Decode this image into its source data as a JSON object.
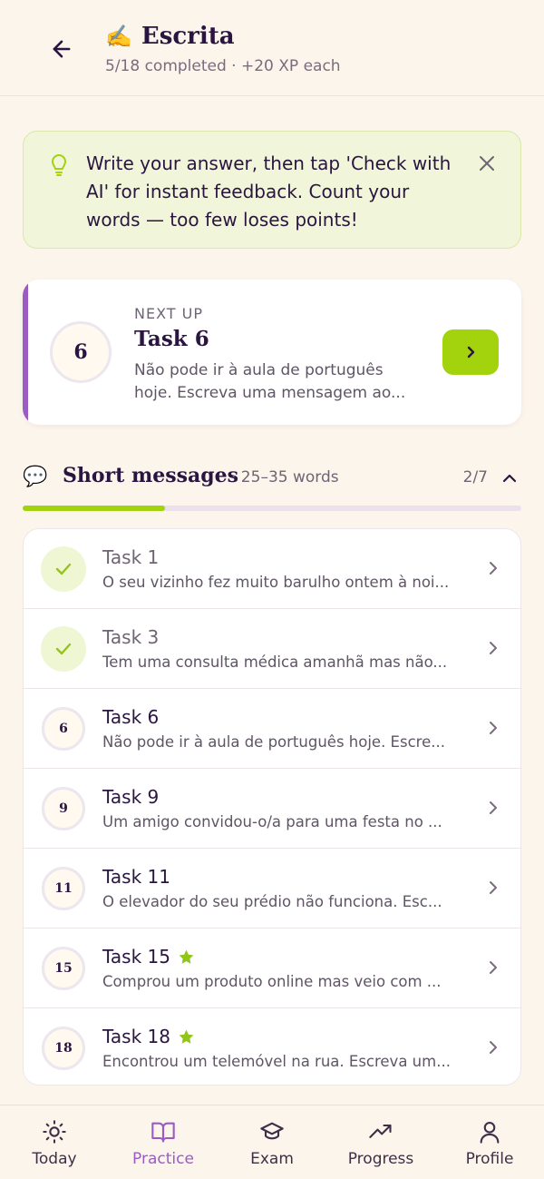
{
  "header": {
    "emoji": "✍️",
    "title": "Escrita",
    "subtitle": "5/18 completed · +20 XP each"
  },
  "tip": {
    "text": "Write your answer, then tap 'Check with AI' for instant feedback. Count your words — too few loses points!"
  },
  "next_up": {
    "label": "NEXT UP",
    "number": "6",
    "title": "Task 6",
    "description": "Não pode ir à aula de português hoje. Escreva uma mensagem ao..."
  },
  "section": {
    "icon": "💬",
    "title": "Short messages",
    "words": "· 25–35 words",
    "count": "2/7",
    "progress": 0.285
  },
  "tasks": [
    {
      "title": "Task 1",
      "desc": "O seu vizinho fez muito barulho ontem à noi...",
      "status": "done"
    },
    {
      "title": "Task 3",
      "desc": "Tem uma consulta médica amanhã mas não...",
      "status": "done"
    },
    {
      "title": "Task 6",
      "number": "6",
      "desc": "Não pode ir à aula de português hoje. Escre...",
      "status": "todo"
    },
    {
      "title": "Task 9",
      "number": "9",
      "desc": "Um amigo convidou-o/a para uma festa no ...",
      "status": "todo"
    },
    {
      "title": "Task 11",
      "number": "11",
      "desc": "O elevador do seu prédio não funciona. Esc...",
      "status": "todo"
    },
    {
      "title": "Task 15",
      "number": "15",
      "desc": "Comprou um produto online mas veio com ...",
      "status": "todo",
      "starred": true
    },
    {
      "title": "Task 18",
      "number": "18",
      "desc": "Encontrou um telemóvel na rua. Escreva um...",
      "status": "todo",
      "starred": true
    }
  ],
  "tabs": [
    {
      "label": "Today",
      "icon": "sun-icon"
    },
    {
      "label": "Practice",
      "icon": "book-icon",
      "active": true
    },
    {
      "label": "Exam",
      "icon": "graduation-cap-icon"
    },
    {
      "label": "Progress",
      "icon": "trending-up-icon"
    },
    {
      "label": "Profile",
      "icon": "user-icon"
    }
  ],
  "colors": {
    "background": "#fcf5ec",
    "accent_purple": "#9b5bc4",
    "accent_green": "#a2d30c",
    "text_dark": "#2a1540"
  }
}
